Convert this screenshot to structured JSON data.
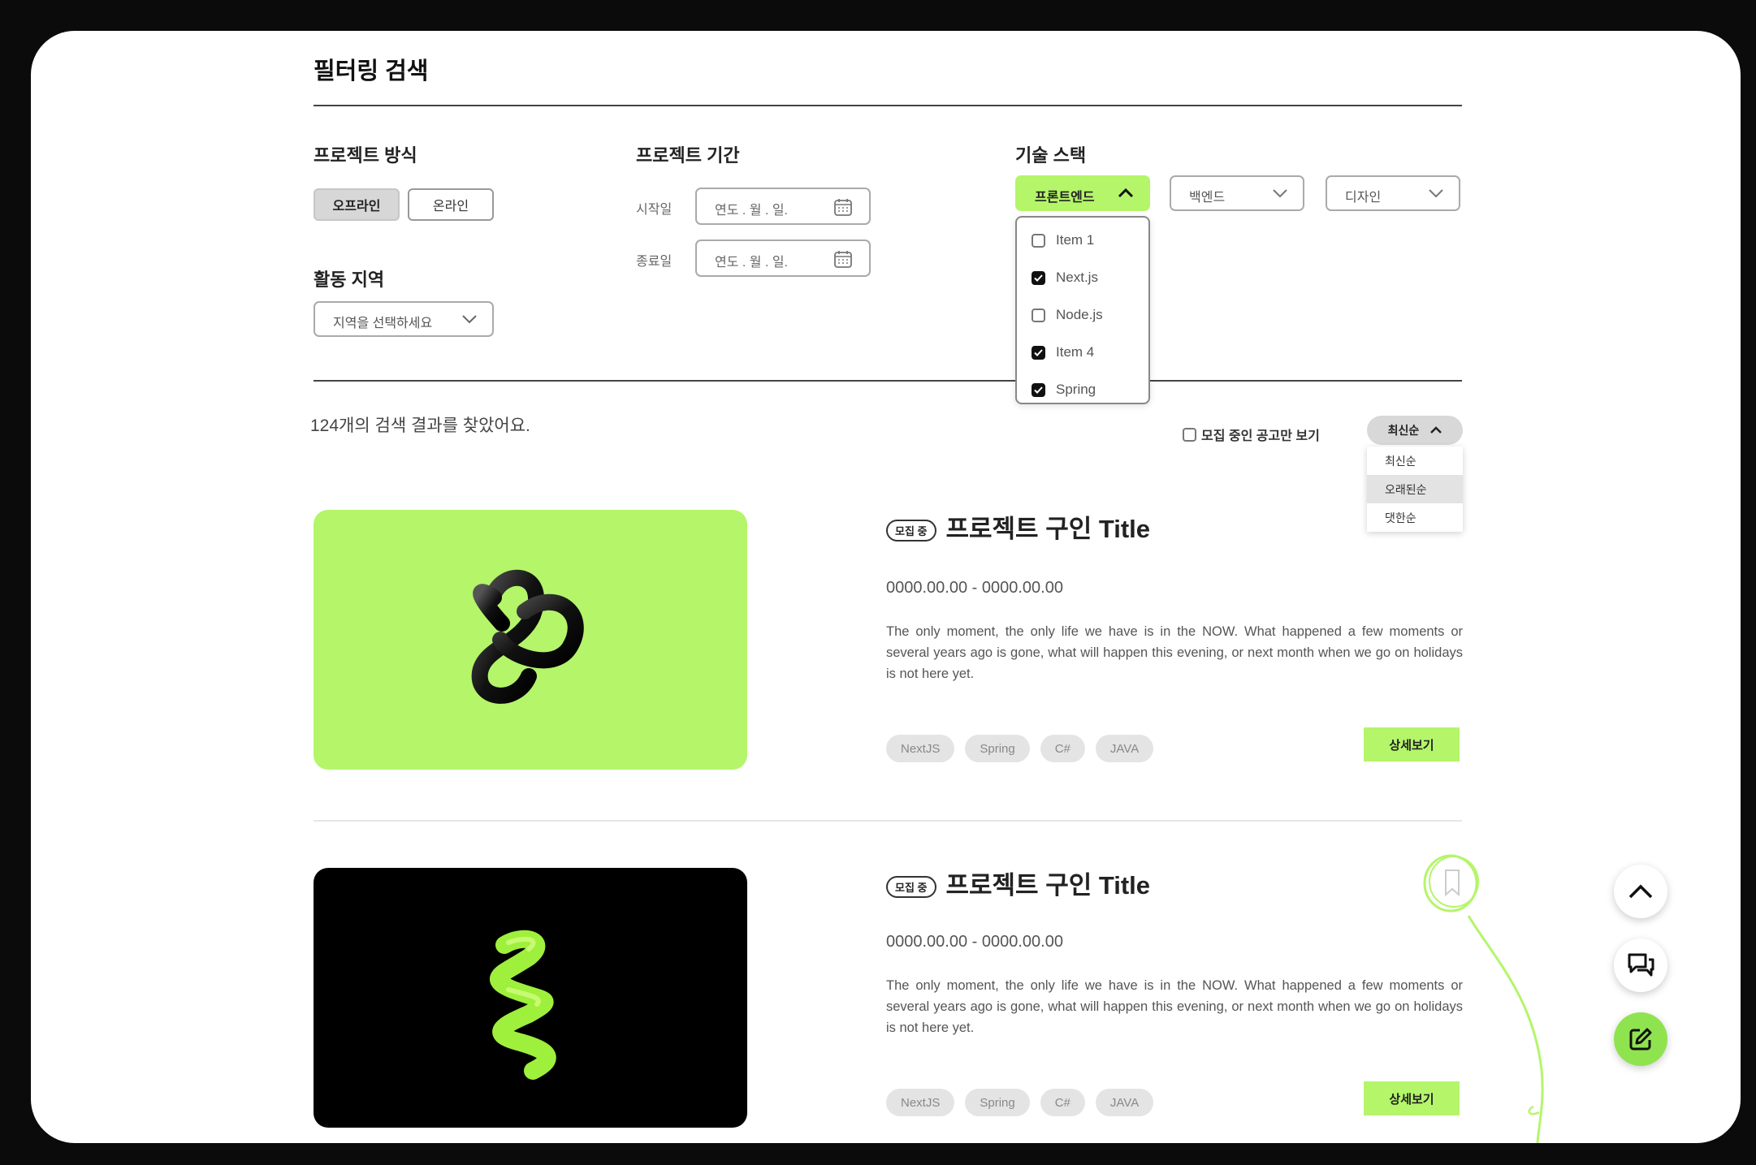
{
  "page": {
    "title": "필터링 검색"
  },
  "filters": {
    "project_mode": {
      "label": "프로젝트 방식",
      "options": [
        "오프라인",
        "온라인"
      ],
      "selected": "오프라인"
    },
    "region": {
      "label": "활동 지역",
      "placeholder": "지역을 선택하세요"
    },
    "period": {
      "label": "프로젝트 기간",
      "start_label": "시작일",
      "end_label": "종료일",
      "date_placeholder": "연도 . 월 . 일."
    },
    "tech_stack": {
      "label": "기술 스택",
      "frontend": "프론트엔드",
      "backend": "백엔드",
      "design": "디자인",
      "frontend_items": [
        {
          "label": "Item 1",
          "checked": false
        },
        {
          "label": "Next.js",
          "checked": true
        },
        {
          "label": "Node.js",
          "checked": false
        },
        {
          "label": "Item 4",
          "checked": true
        },
        {
          "label": "Spring",
          "checked": true
        }
      ]
    }
  },
  "results": {
    "count_text": "124개의 검색 결과를 찾았어요.",
    "recruiting_only_label": "모집 중인 공고만 보기",
    "sort": {
      "selected": "최신순",
      "options": [
        "최신순",
        "오래된순",
        "댓한순"
      ]
    }
  },
  "cards": [
    {
      "badge": "모집 중",
      "title": "프로젝트 구인 Title",
      "date_range": "0000.00.00 - 0000.00.00",
      "description": "The only moment, the only life we have is in the NOW. What happened a few moments or several years ago is gone, what will happen this evening, or next month when we go on holidays is not here yet.",
      "tags": [
        "NextJS",
        "Spring",
        "C#",
        "JAVA"
      ],
      "button": "상세보기",
      "image_bg": "#b4f56a"
    },
    {
      "badge": "모집 중",
      "title": "프로젝트 구인 Title",
      "date_range": "0000.00.00 - 0000.00.00",
      "description": "The only moment, the only life we have is in the NOW. What happened a few moments or several years ago is gone, what will happen this evening, or next month when we go on holidays is not here yet.",
      "tags": [
        "NextJS",
        "Spring",
        "C#",
        "JAVA"
      ],
      "button": "상세보기",
      "image_bg": "#000000"
    }
  ],
  "colors": {
    "accent": "#b4f56a",
    "fab_accent": "#8fe34f",
    "frame": "#0b0b0b"
  },
  "fabs": [
    "chevron-up-icon",
    "chat-icon",
    "edit-icon"
  ]
}
